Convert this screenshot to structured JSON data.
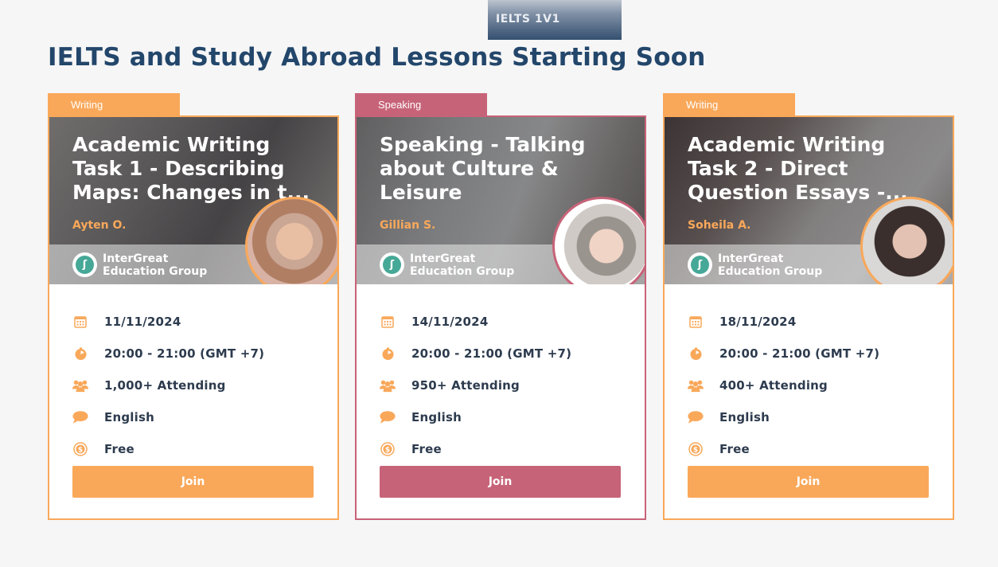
{
  "top_tab": {
    "label": "IELTS 1V1"
  },
  "heading": "IELTS and Study Abroad Lessons Starting Soon",
  "colors": {
    "orange": "#f9a85a",
    "pink": "#c76378",
    "navy": "#23466b",
    "logo_teal": "#46a897"
  },
  "cards": [
    {
      "tag": "Writing",
      "title": "Academic Writing Task 1 - Describing Maps: Changes in t...",
      "host": "Ayten O.",
      "org": "InterGreat Education Group",
      "date": "11/11/2024",
      "time": "20:00 - 21:00 (GMT +7)",
      "attending": "1,000+ Attending",
      "language": "English",
      "price": "Free",
      "join_label": "Join"
    },
    {
      "tag": "Speaking",
      "title": "Speaking - Talking about Culture & Leisure",
      "host": "Gillian S.",
      "org": "InterGreat Education Group",
      "date": "14/11/2024",
      "time": "20:00 - 21:00 (GMT +7)",
      "attending": "950+ Attending",
      "language": "English",
      "price": "Free",
      "join_label": "Join"
    },
    {
      "tag": "Writing",
      "title": "Academic Writing Task 2 - Direct Question Essays -...",
      "host": "Soheila A.",
      "org": "InterGreat Education Group",
      "date": "18/11/2024",
      "time": "20:00 - 21:00 (GMT +7)",
      "attending": "400+ Attending",
      "language": "English",
      "price": "Free",
      "join_label": "Join"
    }
  ],
  "icons": [
    "calendar-icon",
    "clock-icon",
    "people-icon",
    "speech-bubble-icon",
    "coin-icon",
    "org-logo-icon"
  ]
}
